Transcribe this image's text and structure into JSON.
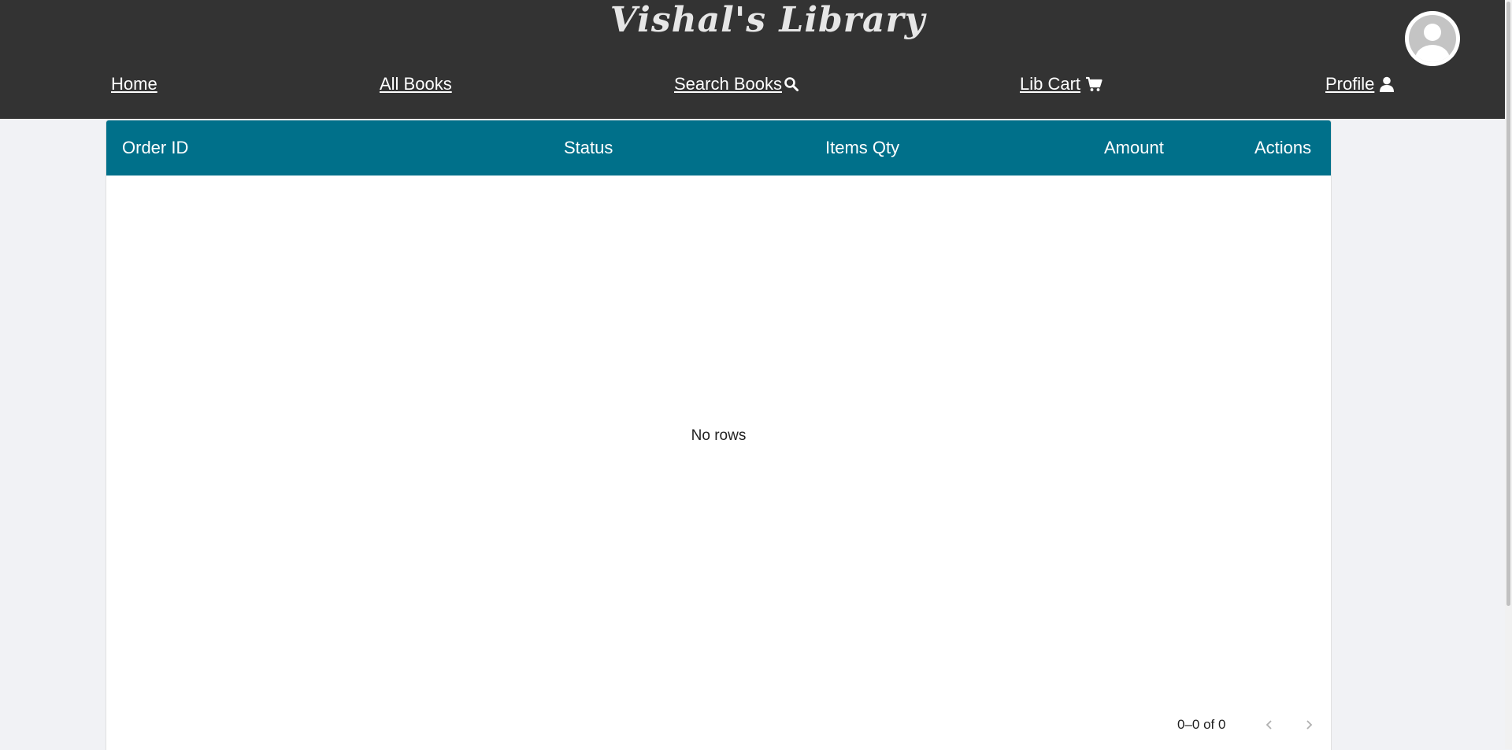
{
  "header": {
    "site_title": "Vishal's Library"
  },
  "nav": {
    "home": "Home",
    "all_books": "All Books",
    "search_books": "Search Books",
    "lib_cart": "Lib Cart",
    "profile": "Profile"
  },
  "table": {
    "columns": [
      "Order ID",
      "Status",
      "Items Qty",
      "Amount",
      "Actions"
    ],
    "empty_message": "No rows",
    "pagination": "0–0 of 0"
  },
  "colors": {
    "header_bg": "#333333",
    "table_header_bg": "#00708a",
    "page_bg": "#f1f2f5"
  },
  "icons": [
    "search-icon",
    "cart-icon",
    "user-icon",
    "avatar-icon",
    "chevron-left-icon",
    "chevron-right-icon"
  ]
}
